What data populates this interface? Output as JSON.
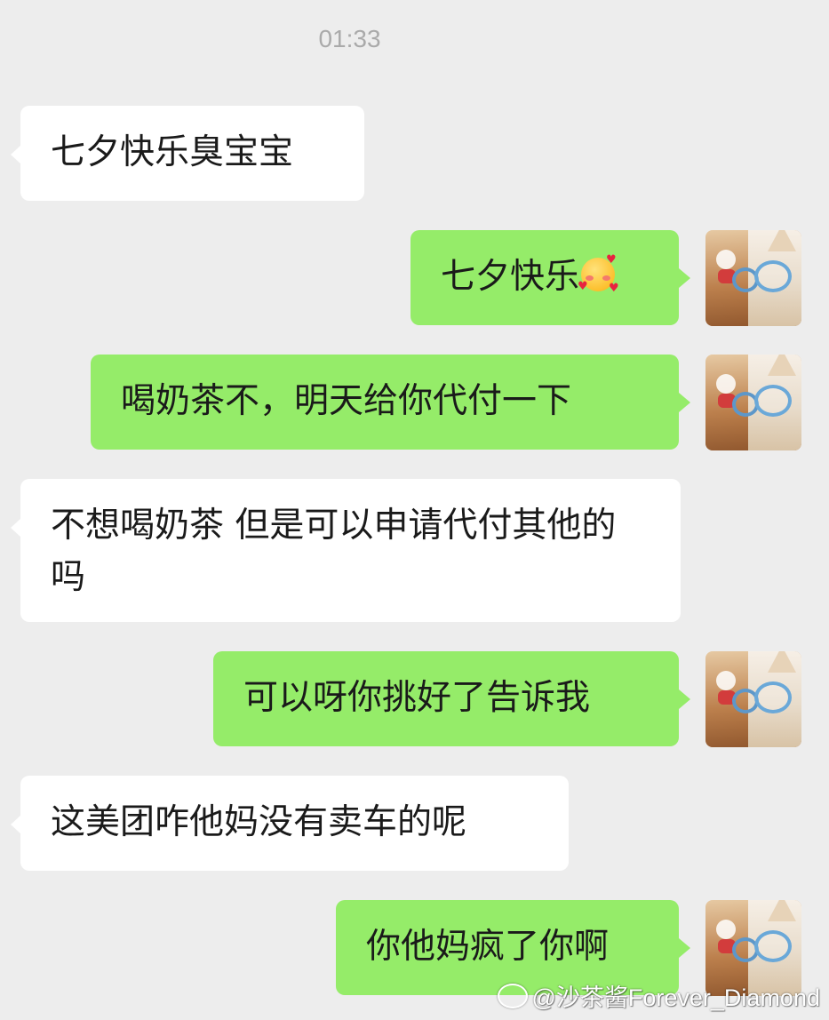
{
  "chat": {
    "timestamp": "01:33",
    "messages": [
      {
        "side": "in",
        "text": "七夕快乐臭宝宝"
      },
      {
        "side": "out",
        "text": "七夕快乐",
        "emoji": "smiling-face-with-hearts"
      },
      {
        "side": "out",
        "text": "喝奶茶不，明天给你代付一下"
      },
      {
        "side": "in",
        "text": "不想喝奶茶 但是可以申请代付其他的吗"
      },
      {
        "side": "out",
        "text": "可以呀你挑好了告诉我"
      },
      {
        "side": "in",
        "text": "这美团咋他妈没有卖车的呢"
      },
      {
        "side": "out",
        "text": "你他妈疯了你啊"
      }
    ]
  },
  "colors": {
    "background": "#ededed",
    "incoming_bubble": "#ffffff",
    "outgoing_bubble": "#95ec69"
  },
  "watermark": {
    "text": "@沙茶酱Forever_Diamond",
    "icon": "weibo-icon"
  }
}
